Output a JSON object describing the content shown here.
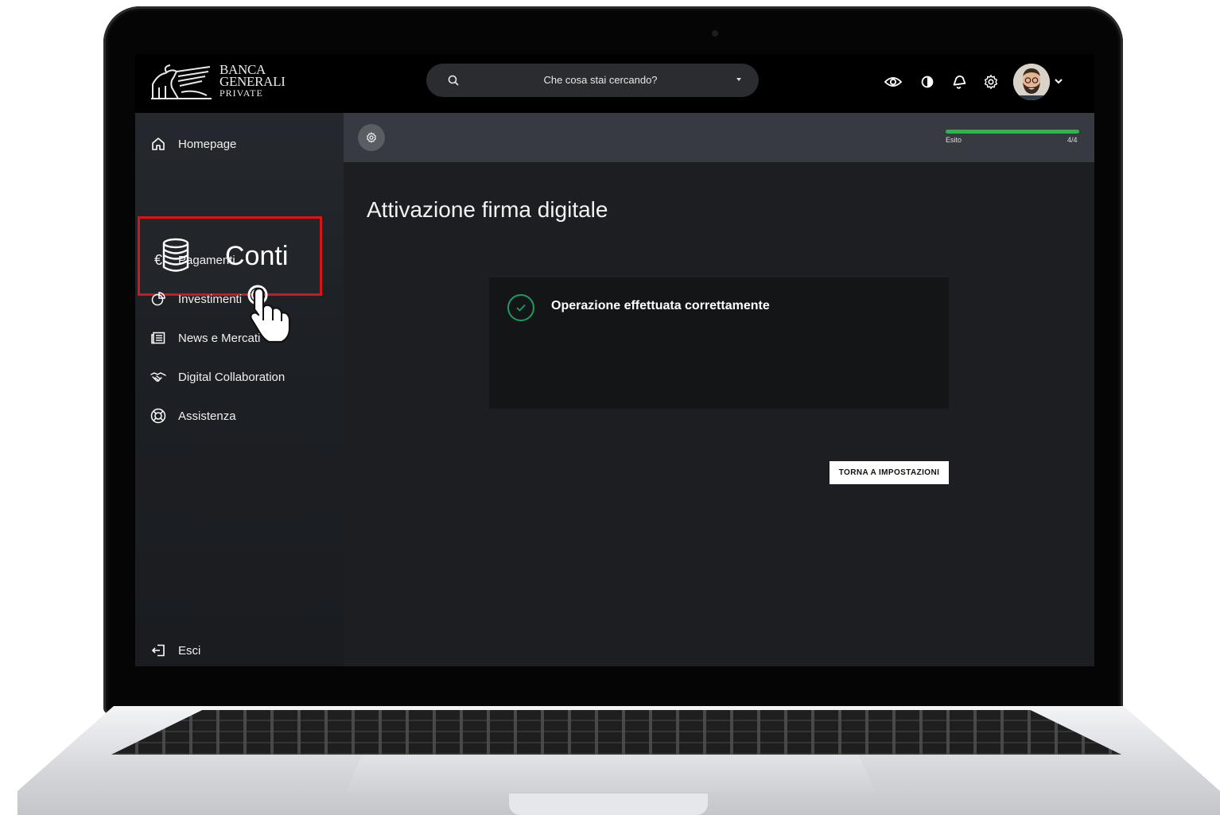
{
  "brand": {
    "line1": "BANCA",
    "line2": "GENERALI",
    "line3": "PRIVATE"
  },
  "search": {
    "placeholder": "Che cosa stai cercando?"
  },
  "topbar_icons": [
    "eye-icon",
    "contrast-icon",
    "bell-icon",
    "gear-icon",
    "avatar",
    "chevron-down-icon"
  ],
  "sidebar": {
    "items": [
      {
        "label": "Homepage",
        "icon": "home-icon"
      },
      {
        "label": "Conti",
        "icon": "database-icon"
      },
      {
        "label": "Pagamenti",
        "icon": "euro-icon"
      },
      {
        "label": "Investimenti",
        "icon": "pie-chart-icon"
      },
      {
        "label": "News e Mercati",
        "icon": "newspaper-icon"
      },
      {
        "label": "Digital Collaboration",
        "icon": "handshake-icon"
      },
      {
        "label": "Assistenza",
        "icon": "lifebuoy-icon"
      }
    ],
    "exit_label": "Esci"
  },
  "progress": {
    "label": "Esito",
    "count": "4/4",
    "fraction": 1.0,
    "color": "#1fbf3f"
  },
  "main": {
    "title": "Attivazione firma digitale",
    "success_message": "Operazione effettuata correttamente",
    "back_button": "TORNA A IMPOSTAZIONI"
  },
  "colors": {
    "highlight_border": "#d8141b",
    "success": "#1e9a63"
  }
}
